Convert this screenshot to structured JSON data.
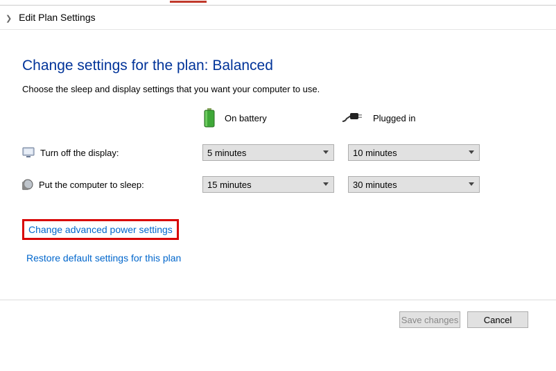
{
  "breadcrumb": {
    "label": "Edit Plan Settings"
  },
  "page": {
    "title": "Change settings for the plan: Balanced",
    "subtitle": "Choose the sleep and display settings that you want your computer to use."
  },
  "columns": {
    "battery": "On battery",
    "plugged": "Plugged in"
  },
  "rows": {
    "display": {
      "label": "Turn off the display:",
      "battery_value": "5 minutes",
      "plugged_value": "10 minutes"
    },
    "sleep": {
      "label": "Put the computer to sleep:",
      "battery_value": "15 minutes",
      "plugged_value": "30 minutes"
    }
  },
  "links": {
    "advanced": "Change advanced power settings",
    "restore": "Restore default settings for this plan"
  },
  "buttons": {
    "save": "Save changes",
    "cancel": "Cancel"
  }
}
